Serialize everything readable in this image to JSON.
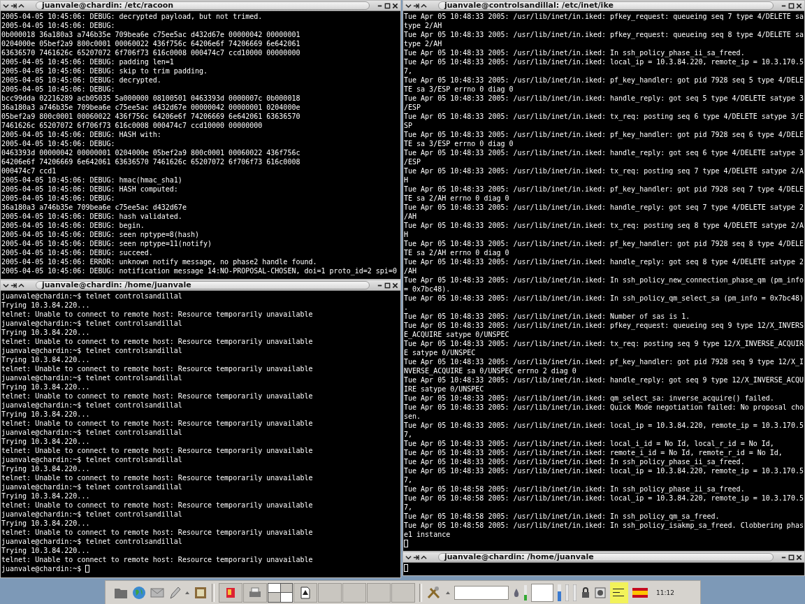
{
  "windows": [
    {
      "title": "juanvale@chardin: /etc/racoon",
      "cursor": false,
      "lines": [
        "2005-04-05 10:45:06: DEBUG: decrypted payload, but not trimed.",
        "2005-04-05 10:45:06: DEBUG:",
        "0b000018 36a180a3 a746b35e 709bea6e c75ee5ac d432d67e 00000042 00000001",
        "0204000e 05bef2a9 800c0001 00060022 436f756c 64206e6f 74206669 6e642061",
        "63636570 7461626c 65207072 6f706f73 616c0008 000474c7 ccd10000 00000000",
        "2005-04-05 10:45:06: DEBUG: padding len=1",
        "2005-04-05 10:45:06: DEBUG: skip to trim padding.",
        "2005-04-05 10:45:06: DEBUG: decrypted.",
        "2005-04-05 10:45:06: DEBUG:",
        "bcc99dda 02216289 acb05035 5a000000 08100501 0463393d 0000007c 0b000018",
        "36a180a3 a746b35e 709bea6e c75ee5ac d432d67e 00000042 00000001 0204000e",
        "05bef2a9 800c0001 00060022 436f756c 64206e6f 74206669 6e642061 63636570",
        "7461626c 65207072 6f706f73 616c0008 000474c7 ccd10000 00000000",
        "2005-04-05 10:45:06: DEBUG: HASH with:",
        "2005-04-05 10:45:06: DEBUG:",
        "0463393d 00000042 00000001 0204000e 05bef2a9 800c0001 00060022 436f756c",
        "64206e6f 74206669 6e642061 63636570 7461626c 65207072 6f706f73 616c0008",
        "000474c7 ccd1",
        "2005-04-05 10:45:06: DEBUG: hmac(hmac_sha1)",
        "2005-04-05 10:45:06: DEBUG: HASH computed:",
        "2005-04-05 10:45:06: DEBUG:",
        "36a180a3 a746b35e 709bea6e c75ee5ac d432d67e",
        "2005-04-05 10:45:06: DEBUG: hash validated.",
        "2005-04-05 10:45:06: DEBUG: begin.",
        "2005-04-05 10:45:06: DEBUG: seen nptype=8(hash)",
        "2005-04-05 10:45:06: DEBUG: seen nptype=11(notify)",
        "2005-04-05 10:45:06: DEBUG: succeed.",
        "2005-04-05 10:45:06: ERROR: unknown notify message, no phase2 handle found.",
        "2005-04-05 10:45:06: DEBUG: notification message 14:NO-PROPOSAL-CHOSEN, doi=1 proto_id=2 spi=0"
      ]
    },
    {
      "title": "juanvale@chardin: /home/juanvale",
      "cursor": true,
      "prompt": "juanvale@chardin:~$",
      "lines": [
        "juanvale@chardin:~$ telnet controlsandillal",
        "Trying 10.3.84.220...",
        "telnet: Unable to connect to remote host: Resource temporarily unavailable",
        "juanvale@chardin:~$ telnet controlsandillal",
        "Trying 10.3.84.220...",
        "telnet: Unable to connect to remote host: Resource temporarily unavailable",
        "juanvale@chardin:~$ telnet controlsandillal",
        "Trying 10.3.84.220...",
        "telnet: Unable to connect to remote host: Resource temporarily unavailable",
        "juanvale@chardin:~$ telnet controlsandillal",
        "Trying 10.3.84.220...",
        "telnet: Unable to connect to remote host: Resource temporarily unavailable",
        "juanvale@chardin:~$ telnet controlsandillal",
        "Trying 10.3.84.220...",
        "telnet: Unable to connect to remote host: Resource temporarily unavailable",
        "juanvale@chardin:~$ telnet controlsandillal",
        "Trying 10.3.84.220...",
        "telnet: Unable to connect to remote host: Resource temporarily unavailable",
        "juanvale@chardin:~$ telnet controlsandillal",
        "Trying 10.3.84.220...",
        "telnet: Unable to connect to remote host: Resource temporarily unavailable",
        "juanvale@chardin:~$ telnet controlsandillal",
        "Trying 10.3.84.220...",
        "telnet: Unable to connect to remote host: Resource temporarily unavailable",
        "juanvale@chardin:~$ telnet controlsandillal",
        "Trying 10.3.84.220...",
        "telnet: Unable to connect to remote host: Resource temporarily unavailable",
        "juanvale@chardin:~$ telnet controlsandillal",
        "Trying 10.3.84.220...",
        "telnet: Unable to connect to remote host: Resource temporarily unavailable"
      ]
    },
    {
      "title": "juanvale@controlsandillal: /etc/inet/ike",
      "cursor": true,
      "lines": [
        "Tue Apr 05 10:48:33 2005: /usr/lib/inet/in.iked: pfkey_request: queueing seq 7 type 4/DELETE satype 2/AH",
        "Tue Apr 05 10:48:33 2005: /usr/lib/inet/in.iked: pfkey_request: queueing seq 8 type 4/DELETE satype 2/AH",
        "Tue Apr 05 10:48:33 2005: /usr/lib/inet/in.iked: In ssh_policy_phase_ii_sa_freed.",
        "Tue Apr 05 10:48:33 2005: /usr/lib/inet/in.iked: local_ip = 10.3.84.220, remote_ip = 10.3.170.57,",
        "Tue Apr 05 10:48:33 2005: /usr/lib/inet/in.iked: pf_key_handler: got pid 7928 seq 5 type 4/DELETE sa 3/ESP errno 0 diag 0",
        "Tue Apr 05 10:48:33 2005: /usr/lib/inet/in.iked: handle_reply: got seq 5 type 4/DELETE satype 3/ESP",
        "Tue Apr 05 10:48:33 2005: /usr/lib/inet/in.iked: tx_req: posting seq 6 type 4/DELETE satype 3/ESP",
        "Tue Apr 05 10:48:33 2005: /usr/lib/inet/in.iked: pf_key_handler: got pid 7928 seq 6 type 4/DELETE sa 3/ESP errno 0 diag 0",
        "Tue Apr 05 10:48:33 2005: /usr/lib/inet/in.iked: handle_reply: got seq 6 type 4/DELETE satype 3/ESP",
        "Tue Apr 05 10:48:33 2005: /usr/lib/inet/in.iked: tx_req: posting seq 7 type 4/DELETE satype 2/AH",
        "Tue Apr 05 10:48:33 2005: /usr/lib/inet/in.iked: pf_key_handler: got pid 7928 seq 7 type 4/DELETE sa 2/AH errno 0 diag 0",
        "Tue Apr 05 10:48:33 2005: /usr/lib/inet/in.iked: handle_reply: got seq 7 type 4/DELETE satype 2/AH",
        "Tue Apr 05 10:48:33 2005: /usr/lib/inet/in.iked: tx_req: posting seq 8 type 4/DELETE satype 2/AH",
        "Tue Apr 05 10:48:33 2005: /usr/lib/inet/in.iked: pf_key_handler: got pid 7928 seq 8 type 4/DELETE sa 2/AH errno 0 diag 0",
        "Tue Apr 05 10:48:33 2005: /usr/lib/inet/in.iked: handle_reply: got seq 8 type 4/DELETE satype 2/AH",
        "Tue Apr 05 10:48:33 2005: /usr/lib/inet/in.iked: In ssh_policy_new_connection_phase_qm (pm_info = 0x7bc48).",
        "Tue Apr 05 10:48:33 2005: /usr/lib/inet/in.iked: In ssh_policy_qm_select_sa (pm_info = 0x7bc48).",
        "Tue Apr 05 10:48:33 2005: /usr/lib/inet/in.iked: Number of sas is 1.",
        "Tue Apr 05 10:48:33 2005: /usr/lib/inet/in.iked: pfkey_request: queueing seq 9 type 12/X_INVERSE_ACQUIRE satype 0/UNSPEC",
        "Tue Apr 05 10:48:33 2005: /usr/lib/inet/in.iked: tx_req: posting seq 9 type 12/X_INVERSE_ACQUIRE satype 0/UNSPEC",
        "Tue Apr 05 10:48:33 2005: /usr/lib/inet/in.iked: pf_key_handler: got pid 7928 seq 9 type 12/X_INVERSE_ACQUIRE sa 0/UNSPEC errno 2 diag 0",
        "Tue Apr 05 10:48:33 2005: /usr/lib/inet/in.iked: handle_reply: got seq 9 type 12/X_INVERSE_ACQUIRE satype 0/UNSPEC",
        "Tue Apr 05 10:48:33 2005: /usr/lib/inet/in.iked: qm_select_sa: inverse_acquire() failed.",
        "Tue Apr 05 10:48:33 2005: /usr/lib/inet/in.iked: Quick Mode negotiation failed: No proposal chosen.",
        "Tue Apr 05 10:48:33 2005: /usr/lib/inet/in.iked: local_ip = 10.3.84.220, remote_ip = 10.3.170.57,",
        "Tue Apr 05 10:48:33 2005: /usr/lib/inet/in.iked: local_i_id = No Id, local_r_id = No Id,",
        "Tue Apr 05 10:48:33 2005: /usr/lib/inet/in.iked: remote_i_id = No Id, remote_r_id = No Id,",
        "Tue Apr 05 10:48:33 2005: /usr/lib/inet/in.iked: In ssh_policy_phase_ii_sa_freed.",
        "Tue Apr 05 10:48:33 2005: /usr/lib/inet/in.iked: local_ip = 10.3.84.220, remote_ip = 10.3.170.57,",
        "Tue Apr 05 10:48:58 2005: /usr/lib/inet/in.iked: In ssh_policy_phase_ii_sa_freed.",
        "Tue Apr 05 10:48:58 2005: /usr/lib/inet/in.iked: local_ip = 10.3.84.220, remote_ip = 10.3.170.57,",
        "Tue Apr 05 10:48:58 2005: /usr/lib/inet/in.iked: In ssh_policy_qm_sa_freed.",
        "Tue Apr 05 10:48:58 2005: /usr/lib/inet/in.iked: In ssh_policy_isakmp_sa_freed. Clobbering phase1 instance"
      ]
    },
    {
      "title": "juanvale@chardin: /home/juanvale",
      "cursor": true
    }
  ],
  "taskbar": {
    "clock": "11:12"
  }
}
